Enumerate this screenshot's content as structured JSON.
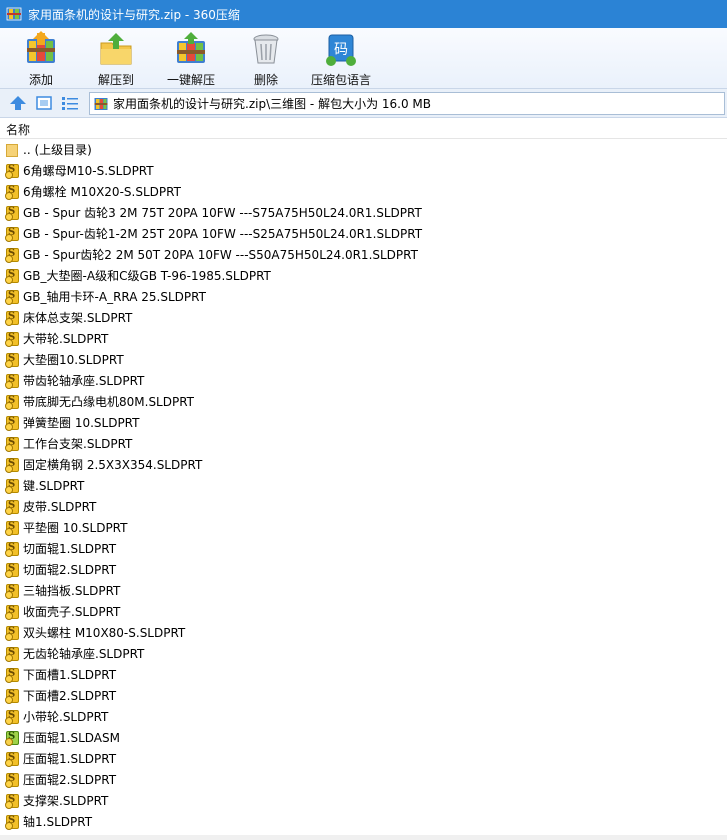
{
  "window": {
    "title": "家用面条机的设计与研究.zip - 360压缩",
    "app_icon": "archive-icon"
  },
  "toolbar": {
    "buttons": [
      {
        "label": "添加",
        "icon": "add-archive-icon"
      },
      {
        "label": "解压到",
        "icon": "extract-to-folder-icon"
      },
      {
        "label": "一键解压",
        "icon": "one-click-extract-icon"
      },
      {
        "label": "删除",
        "icon": "trash-can-icon"
      },
      {
        "label": "压缩包语言",
        "icon": "archive-language-icon",
        "glyph": "码"
      }
    ]
  },
  "addressbar": {
    "path": "家用面条机的设计与研究.zip\\三维图 - 解包大小为 16.0 MB"
  },
  "columns": {
    "name": "名称"
  },
  "files": [
    {
      "name": ".. (上级目录)",
      "type": "parent"
    },
    {
      "name": "6角螺母M10-S.SLDPRT",
      "type": "part"
    },
    {
      "name": "6角螺栓 M10X20-S.SLDPRT",
      "type": "part"
    },
    {
      "name": "GB - Spur 齿轮3 2M 75T 20PA 10FW ---S75A75H50L24.0R1.SLDPRT",
      "type": "part"
    },
    {
      "name": "GB - Spur-齿轮1-2M 25T 20PA 10FW ---S25A75H50L24.0R1.SLDPRT",
      "type": "part"
    },
    {
      "name": "GB - Spur齿轮2 2M 50T 20PA 10FW ---S50A75H50L24.0R1.SLDPRT",
      "type": "part"
    },
    {
      "name": "GB_大垫圈-A级和C级GB T-96-1985.SLDPRT",
      "type": "part"
    },
    {
      "name": "GB_轴用卡环-A_RRA 25.SLDPRT",
      "type": "part"
    },
    {
      "name": "床体总支架.SLDPRT",
      "type": "part"
    },
    {
      "name": "大带轮.SLDPRT",
      "type": "part"
    },
    {
      "name": "大垫圈10.SLDPRT",
      "type": "part"
    },
    {
      "name": "带齿轮轴承座.SLDPRT",
      "type": "part"
    },
    {
      "name": "带底脚无凸缘电机80M.SLDPRT",
      "type": "part"
    },
    {
      "name": "弹簧垫圈 10.SLDPRT",
      "type": "part"
    },
    {
      "name": "工作台支架.SLDPRT",
      "type": "part"
    },
    {
      "name": "固定横角钢 2.5X3X354.SLDPRT",
      "type": "part"
    },
    {
      "name": "键.SLDPRT",
      "type": "part"
    },
    {
      "name": "皮带.SLDPRT",
      "type": "part"
    },
    {
      "name": "平垫圈 10.SLDPRT",
      "type": "part"
    },
    {
      "name": "切面辊1.SLDPRT",
      "type": "part"
    },
    {
      "name": "切面辊2.SLDPRT",
      "type": "part"
    },
    {
      "name": "三轴挡板.SLDPRT",
      "type": "part"
    },
    {
      "name": "收面壳子.SLDPRT",
      "type": "part"
    },
    {
      "name": "双头螺柱 M10X80-S.SLDPRT",
      "type": "part"
    },
    {
      "name": "无齿轮轴承座.SLDPRT",
      "type": "part"
    },
    {
      "name": "下面槽1.SLDPRT",
      "type": "part"
    },
    {
      "name": "下面槽2.SLDPRT",
      "type": "part"
    },
    {
      "name": "小带轮.SLDPRT",
      "type": "part"
    },
    {
      "name": "压面辊1.SLDASM",
      "type": "assembly"
    },
    {
      "name": "压面辊1.SLDPRT",
      "type": "part"
    },
    {
      "name": "压面辊2.SLDPRT",
      "type": "part"
    },
    {
      "name": "支撑架.SLDPRT",
      "type": "part"
    },
    {
      "name": "轴1.SLDPRT",
      "type": "part"
    }
  ]
}
